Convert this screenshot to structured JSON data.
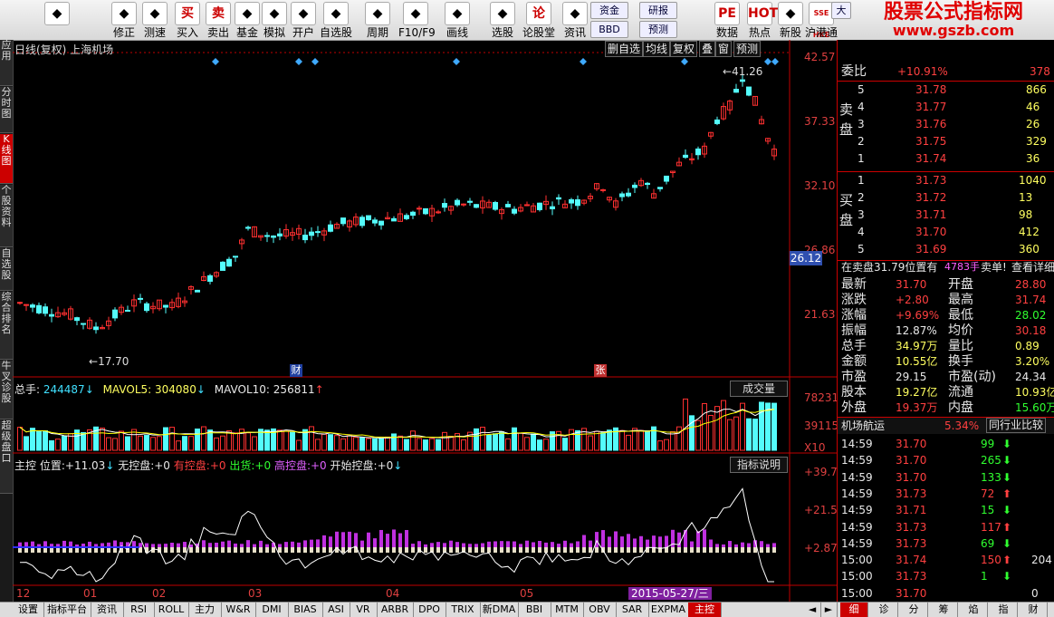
{
  "toolbar": {
    "items": [
      {
        "label": "",
        "icon": "back-arrow-icon"
      },
      {
        "label": "修正",
        "icon": "fix-icon"
      },
      {
        "label": "测速",
        "icon": "clock-icon"
      },
      {
        "label": "买入",
        "icon_text": "买"
      },
      {
        "label": "卖出",
        "icon_text": "卖"
      },
      {
        "label": "基金",
        "icon": "chart-icon"
      },
      {
        "label": "模拟",
        "icon": "gavel-icon"
      },
      {
        "label": "开户",
        "icon": "lock-icon"
      },
      {
        "label": "自选股",
        "icon": "star-icon"
      },
      {
        "label": "周期",
        "icon": "cycle-icon"
      },
      {
        "label": "F10/F9",
        "icon": "f10-icon"
      },
      {
        "label": "画线",
        "icon": "pen-icon"
      },
      {
        "label": "选股",
        "icon": "screen-icon"
      },
      {
        "label": "论股堂",
        "icon_text": "论"
      },
      {
        "label": "资讯",
        "icon": "doc-icon"
      },
      {
        "label": "数据",
        "icon": "pe-icon",
        "icon_text": "PE"
      },
      {
        "label": "热点",
        "icon": "hot-icon",
        "icon_text": "HOT"
      },
      {
        "label": "新股",
        "icon": "new-icon"
      },
      {
        "label": "沪港通",
        "icon": "hk-icon",
        "icon_text": "SSE HKE"
      }
    ],
    "btn_zijin": "资金",
    "btn_bbd": "BBD",
    "btn_yanbao": "研报",
    "btn_yuce": "预测",
    "btn_da": "大"
  },
  "watermark": {
    "line1": "股票公式指标网",
    "line2": "www.gszb.com"
  },
  "left_tabs": [
    "应用",
    "分时图",
    "K线图",
    "个股资料",
    "自选股",
    "综合排名",
    "牛叉诊股",
    "超级盘口"
  ],
  "chart": {
    "title": "日线(复权) 上海机场",
    "buttons": [
      "删自选",
      "均线",
      "复权",
      "叠",
      "窗",
      "预测"
    ],
    "price_axis": [
      "42.57",
      "37.33",
      "32.10",
      "26.86",
      "21.63"
    ],
    "current_price_tag": "26.12",
    "high_label": "41.26",
    "low_label": "17.70",
    "marker_cai": "财",
    "marker_zhang": "张",
    "vol_title": {
      "total_label": "总手:",
      "total_value": "244487",
      "ma5_label": "MAVOL5:",
      "ma5_value": "304080",
      "ma10_label": "MAVOL10:",
      "ma10_value": "256811"
    },
    "vol_button": "成交量",
    "vol_axis": [
      "78231",
      "39115",
      "X10"
    ],
    "ind_title": {
      "name": "主控",
      "pos_label": "位置:",
      "pos_value": "+11.03",
      "l1": "无控盘:",
      "v1": "+0",
      "l2": "有控盘:",
      "v2": "+0",
      "l3": "出货:",
      "v3": "+0",
      "l4": "高控盘:",
      "v4": "+0",
      "l5": "开始控盘:",
      "v5": "+0"
    },
    "ind_button": "指标说明",
    "ind_axis": [
      "+39.77",
      "+21.55",
      "+2.87"
    ],
    "dates": [
      "12",
      "01",
      "02",
      "03",
      "04",
      "05"
    ],
    "cursor_date": "2015-05-27/三"
  },
  "bottom_tabs": [
    "设置",
    "指标平台",
    "资讯",
    "RSI",
    "ROLL",
    "主力",
    "W&R",
    "DMI",
    "BIAS",
    "ASI",
    "VR",
    "ARBR",
    "DPO",
    "TRIX",
    "新DMA",
    "BBI",
    "MTM",
    "OBV",
    "SAR",
    "EXPMA",
    "主控"
  ],
  "right_bottom_tabs": [
    "细",
    "诊",
    "分",
    "筹",
    "焰",
    "指",
    "财"
  ],
  "quote": {
    "weibi_label": "委比",
    "weibi_value": "+10.91%",
    "weibi_diff": "378",
    "sell_label": "卖盘",
    "buy_label": "买盘",
    "sells": [
      {
        "level": "5",
        "price": "31.78",
        "vol": "866"
      },
      {
        "level": "4",
        "price": "31.77",
        "vol": "46"
      },
      {
        "level": "3",
        "price": "31.76",
        "vol": "26"
      },
      {
        "level": "2",
        "price": "31.75",
        "vol": "329"
      },
      {
        "level": "1",
        "price": "31.74",
        "vol": "36"
      }
    ],
    "buys": [
      {
        "level": "1",
        "price": "31.73",
        "vol": "1040"
      },
      {
        "level": "2",
        "price": "31.72",
        "vol": "13"
      },
      {
        "level": "3",
        "price": "31.71",
        "vol": "98"
      },
      {
        "level": "4",
        "price": "31.70",
        "vol": "412"
      },
      {
        "level": "5",
        "price": "31.69",
        "vol": "360"
      }
    ],
    "notice_text": "在卖盘31.79位置有",
    "notice_vol": "4783手",
    "notice_tail": "卖单!",
    "notice_link": "查看详细",
    "stats": [
      {
        "l1": "最新",
        "v1": "31.70",
        "c1": "red",
        "l2": "开盘",
        "v2": "28.80",
        "c2": "red"
      },
      {
        "l1": "涨跌",
        "v1": "+2.80",
        "c1": "red",
        "l2": "最高",
        "v2": "31.74",
        "c2": "red"
      },
      {
        "l1": "涨幅",
        "v1": "+9.69%",
        "c1": "red",
        "l2": "最低",
        "v2": "28.02",
        "c2": "grn"
      },
      {
        "l1": "振幅",
        "v1": "12.87%",
        "c1": "wht",
        "l2": "均价",
        "v2": "30.18",
        "c2": "red"
      },
      {
        "l1": "总手",
        "v1": "34.97万",
        "c1": "yel",
        "l2": "量比",
        "v2": "0.89",
        "c2": "yel"
      },
      {
        "l1": "金额",
        "v1": "10.55亿",
        "c1": "yel",
        "l2": "换手",
        "v2": "3.20%",
        "c2": "yel"
      },
      {
        "l1": "市盈",
        "v1": "29.15",
        "c1": "wht",
        "l2": "市盈(动)",
        "v2": "24.34",
        "c2": "wht"
      },
      {
        "l1": "股本",
        "v1": "19.27亿",
        "c1": "yel",
        "l2": "流通",
        "v2": "10.93亿",
        "c2": "yel"
      },
      {
        "l1": "外盘",
        "v1": "19.37万",
        "c1": "red",
        "l2": "内盘",
        "v2": "15.60万",
        "c2": "grn"
      }
    ],
    "industry_label": "机场航运",
    "industry_pct": "5.34%",
    "industry_btn": "同行业比较",
    "ticks": [
      {
        "t": "14:59",
        "p": "31.70",
        "pc": "red",
        "v": "99",
        "d": "down"
      },
      {
        "t": "14:59",
        "p": "31.70",
        "pc": "red",
        "v": "265",
        "d": "down"
      },
      {
        "t": "14:59",
        "p": "31.70",
        "pc": "red",
        "v": "133",
        "d": "down"
      },
      {
        "t": "14:59",
        "p": "31.73",
        "pc": "red",
        "v": "72",
        "d": "up"
      },
      {
        "t": "14:59",
        "p": "31.71",
        "pc": "red",
        "v": "15",
        "d": "down"
      },
      {
        "t": "14:59",
        "p": "31.73",
        "pc": "red",
        "v": "117",
        "d": "up"
      },
      {
        "t": "14:59",
        "p": "31.73",
        "pc": "red",
        "v": "69",
        "d": "down"
      },
      {
        "t": "15:00",
        "p": "31.74",
        "pc": "red",
        "v": "150",
        "d": "up",
        "extra": "204"
      },
      {
        "t": "15:00",
        "p": "31.73",
        "pc": "red",
        "v": "1",
        "d": "down"
      },
      {
        "t": "15:00",
        "p": "31.70",
        "pc": "red",
        "v": "",
        "d": "",
        "extra": "0"
      }
    ]
  },
  "colors": {
    "up": "#ff3030",
    "down": "#54fcfc",
    "axis": "#c00000",
    "ma5": "#ffffff",
    "ma10": "#ffff00",
    "diamond": "#3fa9ff",
    "indicator": "#c030e0"
  }
}
